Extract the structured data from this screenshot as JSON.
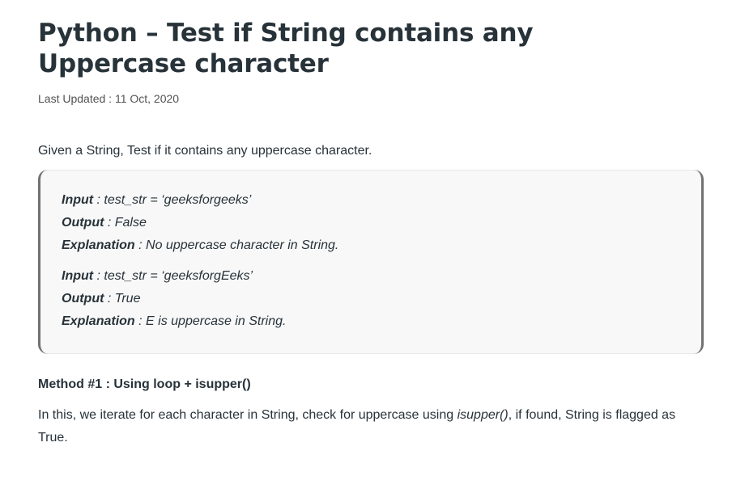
{
  "article": {
    "title": "Python – Test if String contains any Uppercase character",
    "last_updated_label": "Last Updated : ",
    "last_updated_date": "11 Oct, 2020",
    "intro": "Given a String, Test if it contains any uppercase character.",
    "examples": [
      {
        "input_label": "Input",
        "input_value": " : test_str = ‘geeksforgeeks’",
        "output_label": "Output",
        "output_value": " : False",
        "explanation_label": "Explanation",
        "explanation_value": " : No uppercase character in String."
      },
      {
        "input_label": "Input",
        "input_value": " : test_str = ‘geeksforgEeks’",
        "output_label": "Output",
        "output_value": " : True",
        "explanation_label": "Explanation",
        "explanation_value": " : E is uppercase in String."
      }
    ],
    "method_heading": "Method #1 : Using loop + isupper()",
    "method_text_1": "In this, we iterate for each character in String, check for uppercase using ",
    "method_code": "isupper()",
    "method_text_2": ", if found, String is flagged as True."
  }
}
